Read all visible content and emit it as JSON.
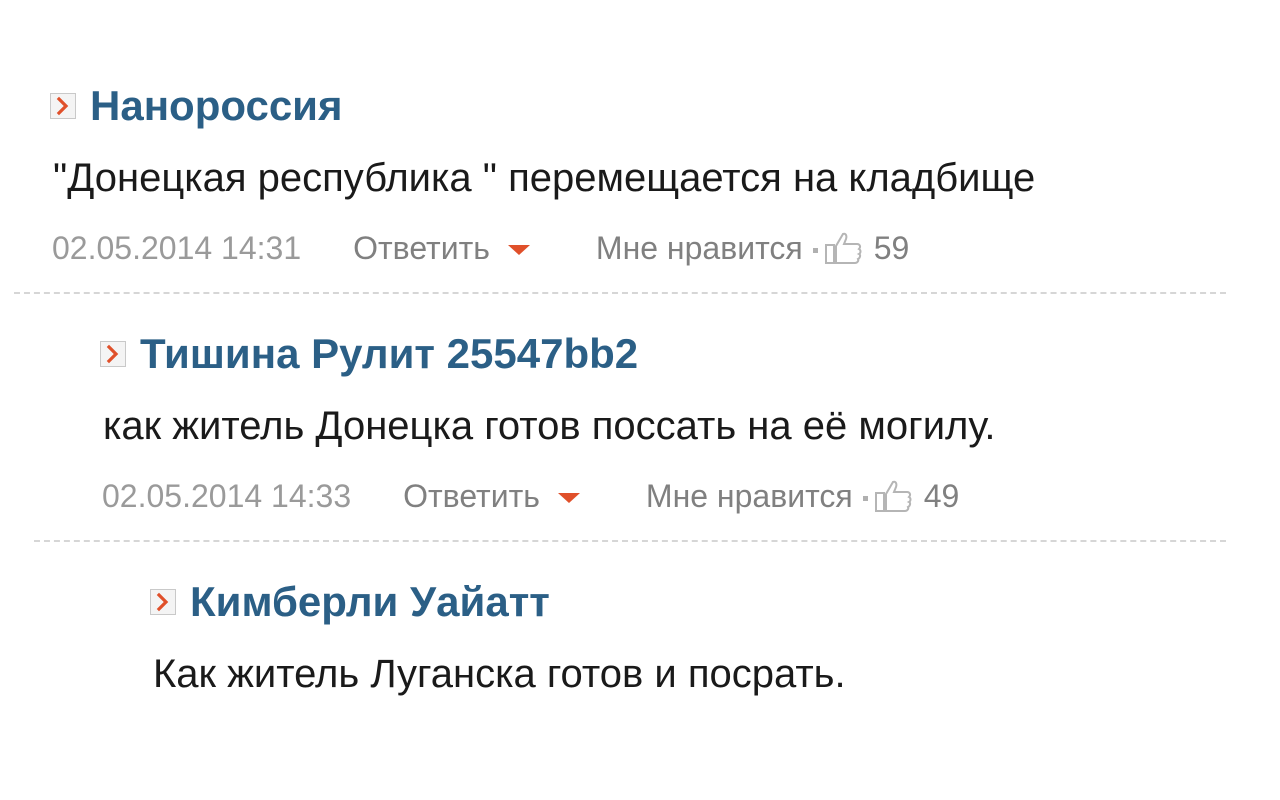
{
  "accent_color": "#2b5f86",
  "caret_color": "#e0502a",
  "comments": [
    {
      "author": "Нанороссия",
      "text": "\"Донецкая республика \" перемещается на кладбище",
      "date": "02.05.2014 14:31",
      "reply_label": "Ответить",
      "like_label": "Мне нравится",
      "likes": "59"
    },
    {
      "author": "Тишина Рулит 25547bb2",
      "text": "как житель Донецка готов поссать на её могилу.",
      "date": "02.05.2014 14:33",
      "reply_label": "Ответить",
      "like_label": "Мне нравится",
      "likes": "49"
    },
    {
      "author": "Кимберли Уайатт",
      "text": "Как житель Луганска готов и посрать."
    }
  ]
}
